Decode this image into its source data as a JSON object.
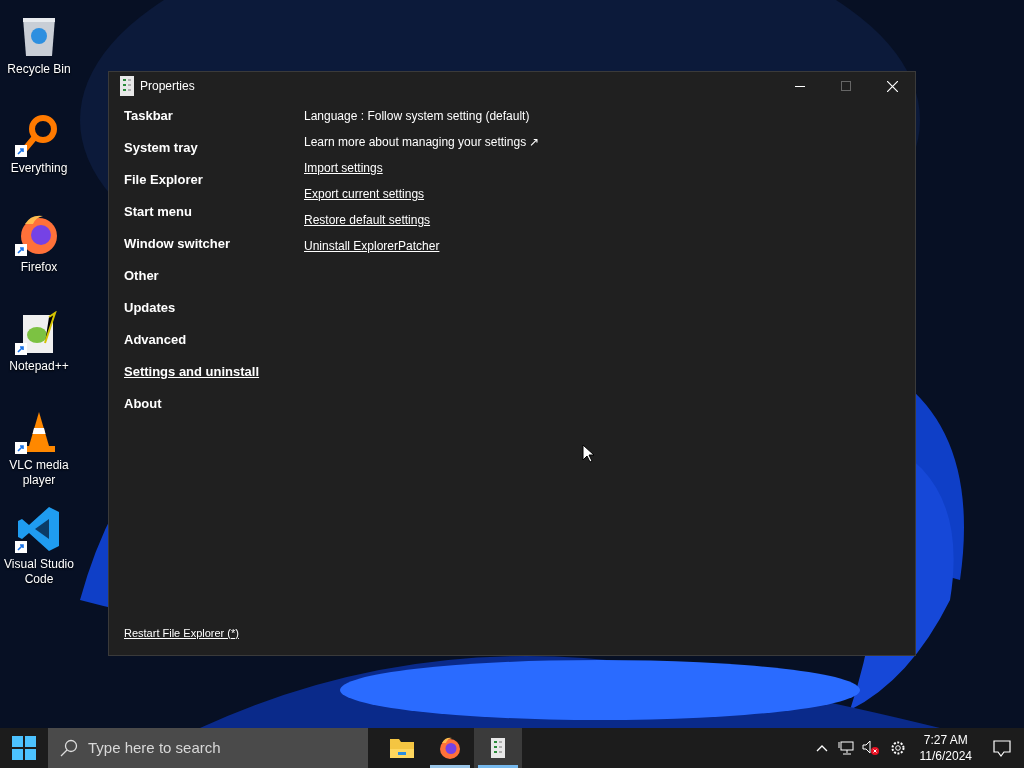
{
  "desktop_icons": [
    {
      "kind": "recycle",
      "label": "Recycle Bin",
      "shortcut": false
    },
    {
      "kind": "everything",
      "label": "Everything",
      "shortcut": true
    },
    {
      "kind": "firefox",
      "label": "Firefox",
      "shortcut": true
    },
    {
      "kind": "notepad",
      "label": "Notepad++",
      "shortcut": true
    },
    {
      "kind": "vlc",
      "label": "VLC media player",
      "shortcut": true
    },
    {
      "kind": "vscode",
      "label": "Visual Studio Code",
      "shortcut": true
    }
  ],
  "window": {
    "title": "Properties",
    "sidebar": {
      "items": [
        {
          "label": "Taskbar",
          "selected": false
        },
        {
          "label": "System tray",
          "selected": false
        },
        {
          "label": "File Explorer",
          "selected": false
        },
        {
          "label": "Start menu",
          "selected": false
        },
        {
          "label": "Window switcher",
          "selected": false
        },
        {
          "label": "Other",
          "selected": false
        },
        {
          "label": "Updates",
          "selected": false
        },
        {
          "label": "Advanced",
          "selected": false
        },
        {
          "label": "Settings and uninstall",
          "selected": true
        },
        {
          "label": "About",
          "selected": false
        }
      ],
      "footer_link": "Restart File Explorer (*)"
    },
    "content": [
      {
        "kind": "text",
        "label": "Language : Follow system setting (default)"
      },
      {
        "kind": "external",
        "label": "Learn more about managing your settings ↗"
      },
      {
        "kind": "link",
        "label": "Import settings"
      },
      {
        "kind": "link",
        "label": "Export current settings"
      },
      {
        "kind": "link",
        "label": "Restore default settings"
      },
      {
        "kind": "link",
        "label": "Uninstall ExplorerPatcher"
      }
    ]
  },
  "taskbar": {
    "search": {
      "placeholder": "Type here to search"
    },
    "apps": [
      {
        "kind": "explorer",
        "running": false,
        "selected": false
      },
      {
        "kind": "firefox",
        "running": true,
        "selected": false
      },
      {
        "kind": "properties",
        "running": true,
        "selected": true
      }
    ],
    "clock": {
      "time": "7:27 AM",
      "date": "11/6/2024"
    }
  }
}
